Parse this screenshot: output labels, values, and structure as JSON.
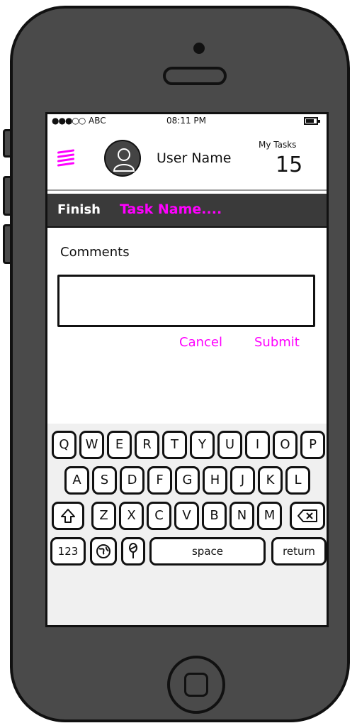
{
  "status_bar": {
    "signal": "●●●○○",
    "carrier": "ABC",
    "time": "08:11 PM"
  },
  "header": {
    "user_name": "User Name",
    "my_tasks_label": "My Tasks",
    "my_tasks_count": "15"
  },
  "title_bar": {
    "action": "Finish",
    "task_name": "Task Name...."
  },
  "form": {
    "comments_label": "Comments",
    "comments_value": "",
    "cancel_label": "Cancel",
    "submit_label": "Submit"
  },
  "keyboard": {
    "row1": [
      "Q",
      "W",
      "E",
      "R",
      "T",
      "Y",
      "U",
      "I",
      "O",
      "P"
    ],
    "row2": [
      "A",
      "S",
      "D",
      "F",
      "G",
      "H",
      "J",
      "K",
      "L"
    ],
    "row3": [
      "Z",
      "X",
      "C",
      "V",
      "B",
      "N",
      "M"
    ],
    "numbers_key": "123",
    "space_key": "space",
    "return_key": "return"
  },
  "icons": [
    "menu-icon",
    "avatar-icon",
    "battery-icon",
    "shift-icon",
    "backspace-icon",
    "globe-icon",
    "microphone-icon",
    "home-button"
  ],
  "colors": {
    "accent": "#ff00ff",
    "title_bar": "#3a3a3a",
    "device": "#4a4a4a"
  }
}
